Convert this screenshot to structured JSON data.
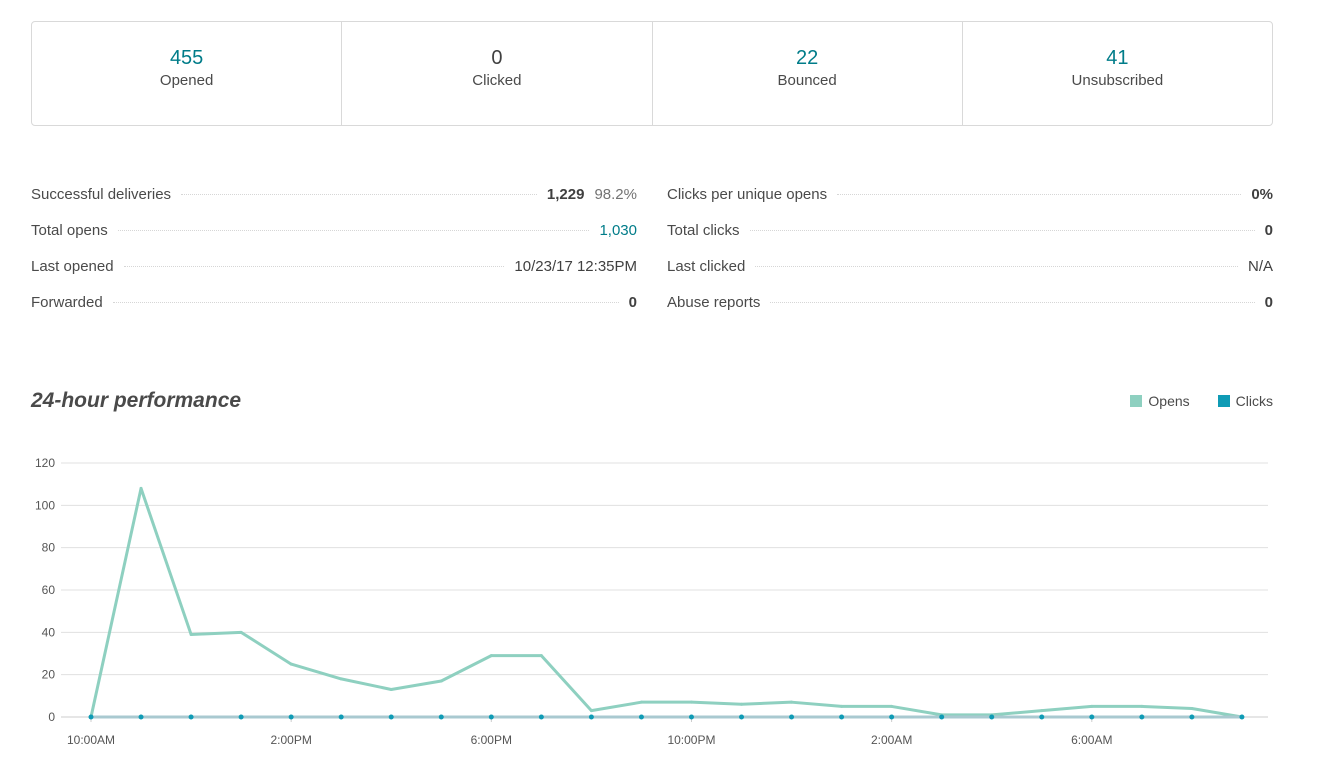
{
  "summary": [
    {
      "value": "455",
      "label": "Opened",
      "accent": true
    },
    {
      "value": "0",
      "label": "Clicked",
      "accent": false
    },
    {
      "value": "22",
      "label": "Bounced",
      "accent": true
    },
    {
      "value": "41",
      "label": "Unsubscribed",
      "accent": true
    }
  ],
  "details_left": [
    {
      "label": "Successful deliveries",
      "value": "1,229",
      "pct": "98.2%"
    },
    {
      "label": "Total opens",
      "value": "1,030"
    },
    {
      "label": "Last opened",
      "value": "10/23/17 12:35PM"
    },
    {
      "label": "Forwarded",
      "value": "0"
    }
  ],
  "details_right": [
    {
      "label": "Clicks per unique opens",
      "value": "0%"
    },
    {
      "label": "Total clicks",
      "value": "0"
    },
    {
      "label": "Last clicked",
      "value": "N/A"
    },
    {
      "label": "Abuse reports",
      "value": "0"
    }
  ],
  "colors": {
    "accent": "#007c89",
    "opens": "#8ed0c0",
    "clicks": "#0f9bb5"
  },
  "chart_data": {
    "type": "line",
    "title": "24-hour performance",
    "xlabel": "",
    "ylabel": "",
    "ylim": [
      0,
      120
    ],
    "yticks": [
      0,
      20,
      40,
      60,
      80,
      100,
      120
    ],
    "grid": true,
    "legend": "top-right",
    "x": [
      "10:00AM",
      "11:00AM",
      "12:00PM",
      "1:00PM",
      "2:00PM",
      "3:00PM",
      "4:00PM",
      "5:00PM",
      "6:00PM",
      "7:00PM",
      "8:00PM",
      "9:00PM",
      "10:00PM",
      "11:00PM",
      "12:00AM",
      "1:00AM",
      "2:00AM",
      "3:00AM",
      "4:00AM",
      "5:00AM",
      "6:00AM",
      "7:00AM",
      "8:00AM",
      "9:00AM"
    ],
    "xtick_labels": [
      {
        "index": 0,
        "label": "10:00AM"
      },
      {
        "index": 4,
        "label": "2:00PM"
      },
      {
        "index": 8,
        "label": "6:00PM"
      },
      {
        "index": 12,
        "label": "10:00PM"
      },
      {
        "index": 16,
        "label": "2:00AM"
      },
      {
        "index": 20,
        "label": "6:00AM"
      }
    ],
    "series": [
      {
        "name": "Opens",
        "values": [
          0,
          108,
          39,
          40,
          25,
          18,
          13,
          17,
          29,
          29,
          3,
          7,
          7,
          6,
          7,
          5,
          5,
          1,
          1,
          3,
          5,
          5,
          4,
          0
        ]
      },
      {
        "name": "Clicks",
        "values": [
          0,
          0,
          0,
          0,
          0,
          0,
          0,
          0,
          0,
          0,
          0,
          0,
          0,
          0,
          0,
          0,
          0,
          0,
          0,
          0,
          0,
          0,
          0,
          0
        ]
      }
    ]
  }
}
